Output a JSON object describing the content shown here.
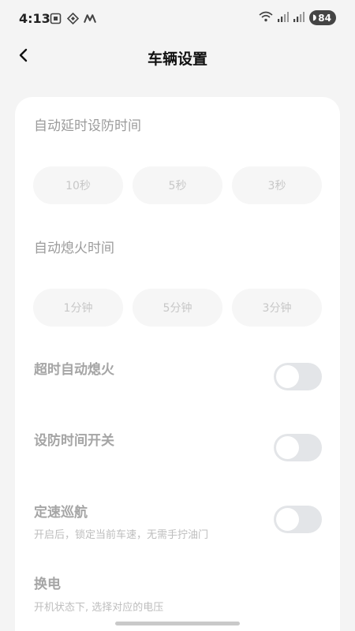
{
  "status_bar": {
    "time": "4:13",
    "battery": "84",
    "icons": [
      "screenshot-icon",
      "signal-diamond-icon",
      "m-logo-icon",
      "wifi-icon",
      "cell-signal-icon",
      "cell-signal-icon",
      "battery-icon"
    ]
  },
  "header": {
    "title": "车辆设置",
    "back_icon": "chevron-left-icon"
  },
  "settings": {
    "arm_delay": {
      "title": "自动延时设防时间",
      "options": [
        "10秒",
        "5秒",
        "3秒"
      ]
    },
    "engine_off_time": {
      "title": "自动熄火时间",
      "options": [
        "1分钟",
        "5分钟",
        "3分钟"
      ]
    },
    "timeout_auto_off": {
      "title": "超时自动熄火",
      "enabled": false
    },
    "arm_time_switch": {
      "title": "设防时间开关",
      "enabled": false
    },
    "cruise_control": {
      "title": "定速巡航",
      "subtitle": "开启后，锁定当前车速，无需手拧油门",
      "enabled": false
    },
    "battery_swap": {
      "title": "换电",
      "subtitle": "开机状态下, 选择对应的电压"
    }
  },
  "colors": {
    "background": "#f4f4f4",
    "card": "#ffffff",
    "toggle_off": "#e3e5e8",
    "muted_text": "#9b9b9b"
  }
}
